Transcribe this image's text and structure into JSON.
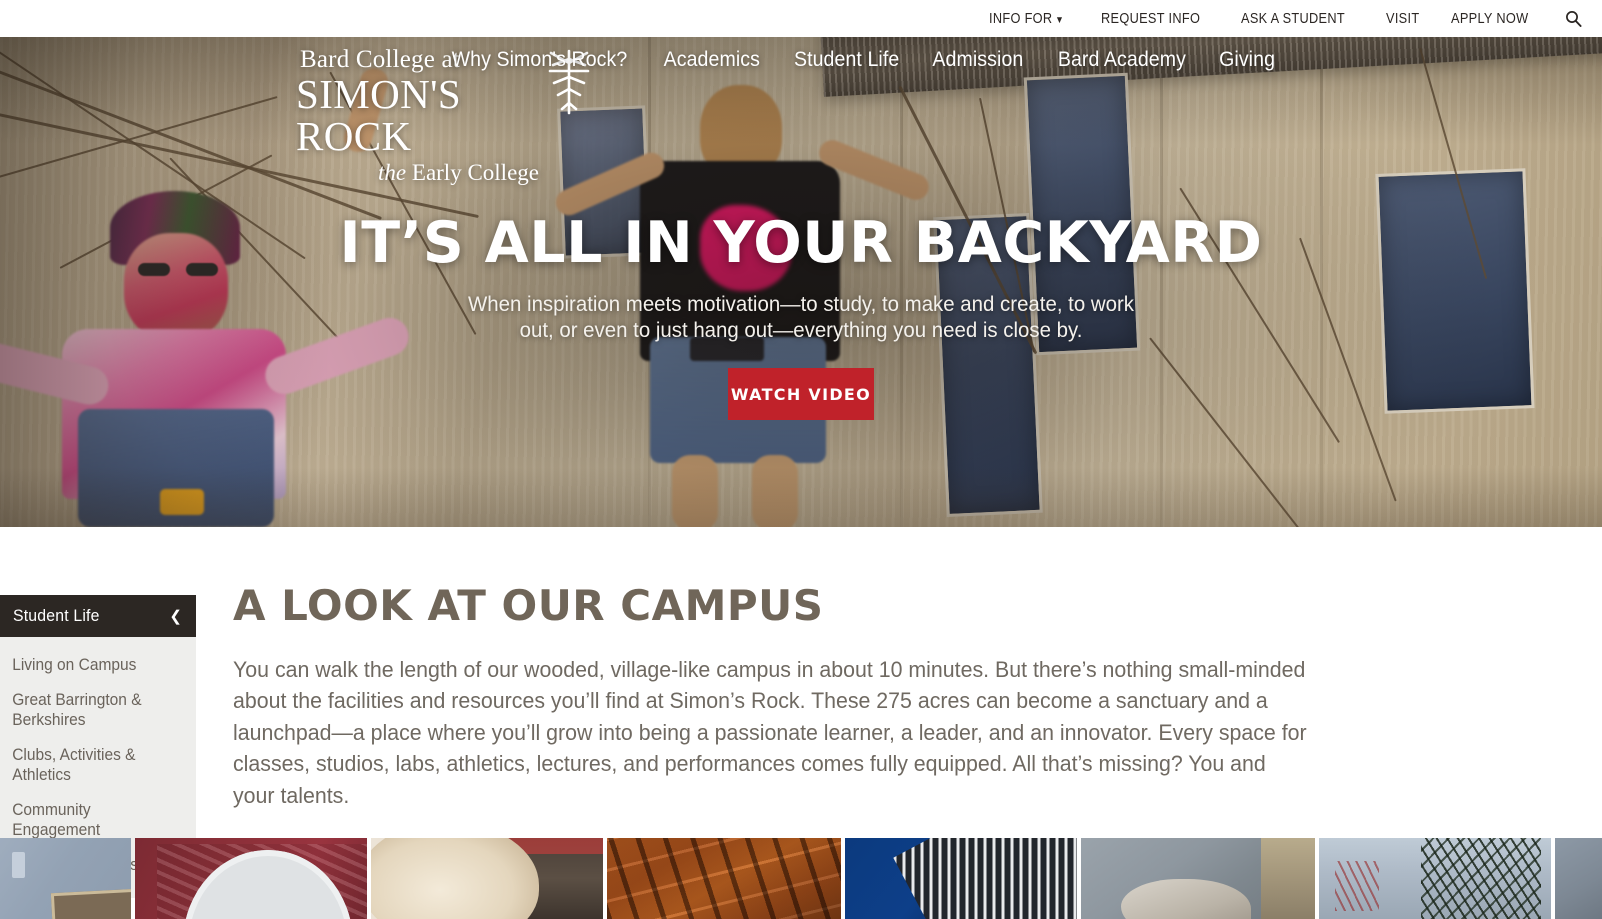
{
  "utility_bar": {
    "links": [
      {
        "label": "INFO FOR",
        "has_caret": true,
        "caret": "▼"
      },
      {
        "label": "REQUEST INFO",
        "has_caret": false
      },
      {
        "label": "ASK A STUDENT",
        "has_caret": false
      },
      {
        "label": "VISIT",
        "has_caret": false
      },
      {
        "label": "APPLY NOW",
        "has_caret": false
      }
    ],
    "search_icon": "search-icon"
  },
  "logo": {
    "line1": "Bard College at",
    "line2": "SIMON'S ROCK",
    "line3_italic": "the",
    "line3_rest": " Early College",
    "ornament": "snowflake-icon"
  },
  "main_nav": {
    "items": [
      {
        "label": "Why Simon's Rock?"
      },
      {
        "label": "Academics"
      },
      {
        "label": "Student Life"
      },
      {
        "label": "Admission"
      },
      {
        "label": "Bard Academy"
      },
      {
        "label": "Giving"
      }
    ]
  },
  "hero": {
    "title": "It’s all In Your Backyard",
    "subtitle": "When inspiration meets motivation—to study, to make and create, to work out, or even to just hang out—everything you need is close by.",
    "cta_label": "Watch Video",
    "cta_color": "#c0222a"
  },
  "sidebar": {
    "header_label": "Student Life",
    "collapse_icon": "chevron-left-icon",
    "header_bg": "#2c2723",
    "list_bg": "#eeeeec",
    "items": [
      {
        "label": "Living on Campus"
      },
      {
        "label": "Great Barrington & Berkshires"
      },
      {
        "label": "Clubs, Activities & Athletics"
      },
      {
        "label": "Community Engagement"
      },
      {
        "label": "Maps & Directions"
      }
    ]
  },
  "main": {
    "title": "A Look at Our Campus",
    "body": "You can walk the length of our wooded, village-like campus in about 10 minutes. But there’s nothing small-minded about the facilities and resources you’ll find at Simon’s Rock. These 275 acres can become a sanctuary and a launchpad—a place where you’ll grow into being a passionate learner, a leader, and an innovator. Every space for classes, studios, labs, athletics, lectures, and performances comes fully equipped. All that’s missing? You and your talents.",
    "title_color": "#706659",
    "body_color": "#6f6961"
  },
  "image_strip": {
    "tiles": [
      {
        "name": "classroom-wall-photo"
      },
      {
        "name": "red-barn-cupola-photo"
      },
      {
        "name": "student-blonde-hair-photo"
      },
      {
        "name": "wooden-rafters-photo"
      },
      {
        "name": "blue-building-facade-photo"
      },
      {
        "name": "stone-sculpture-photo"
      },
      {
        "name": "pine-trees-sky-photo"
      },
      {
        "name": "campus-building-photo"
      }
    ]
  }
}
